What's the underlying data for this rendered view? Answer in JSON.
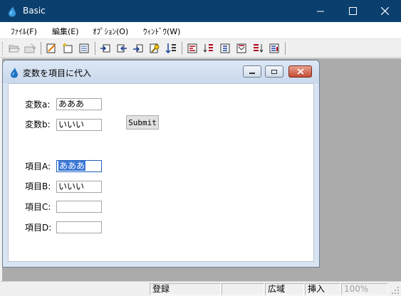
{
  "window": {
    "title": "Basic",
    "controls": [
      "minimize",
      "maximize",
      "close"
    ]
  },
  "menu": {
    "items": [
      {
        "label": "ﾌｧｲﾙ(F)"
      },
      {
        "label": "編集(E)"
      },
      {
        "label": "ｵﾌﾟｼｮﾝ(O)"
      },
      {
        "label": "ｳｨﾝﾄﾞｳ(W)"
      }
    ]
  },
  "toolbar": {
    "icons": [
      "open-folder-icon",
      "back-folder-icon",
      "edit-page-icon",
      "new-doc-icon",
      "list-page-icon",
      "insert-left-icon",
      "insert-before-icon",
      "insert-after-icon",
      "key-icon",
      "sort-icon",
      "align-icon",
      "sort-down-icon",
      "move-left-icon",
      "move-right-icon",
      "sort-list-icon",
      "layout-icon"
    ]
  },
  "child": {
    "title": "変数を項目に代入",
    "labels": {
      "var_a": "変数a:",
      "var_b": "変数b:",
      "item_a": "項目A:",
      "item_b": "項目B:",
      "item_c": "項目C:",
      "item_d": "項目D:"
    },
    "values": {
      "var_a": "あああ",
      "var_b": "いいい",
      "item_a": "あああ",
      "item_b": "いいい",
      "item_c": "",
      "item_d": ""
    },
    "submit_label": "Submit"
  },
  "statusbar": {
    "mode": "登録",
    "wide": "広域",
    "insert": "挿入",
    "zoom": "100%"
  },
  "colors": {
    "titlebar": "#0b3f6e",
    "mdi_background": "#ababab",
    "selection": "#3b78d8",
    "child_frame": "#d9e4f2"
  }
}
